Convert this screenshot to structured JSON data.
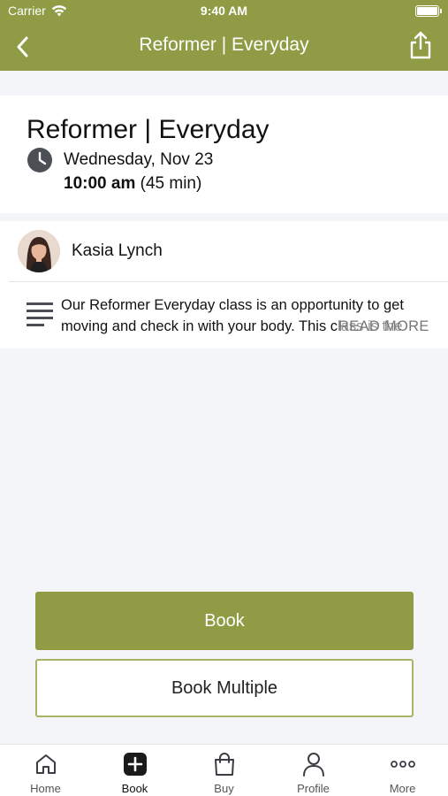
{
  "status_bar": {
    "carrier": "Carrier",
    "time": "9:40 AM"
  },
  "nav": {
    "title": "Reformer | Everyday"
  },
  "class_info": {
    "title": "Reformer | Everyday",
    "date": "Wednesday, Nov 23",
    "time": "10:00 am",
    "duration": "(45 min)"
  },
  "instructor": {
    "name": "Kasia Lynch"
  },
  "description": {
    "text": "Our Reformer Everyday class is an opportunity to get moving and check in with your body. This class is the",
    "read_more": "READ MORE"
  },
  "actions": {
    "book_label": "Book",
    "book_multiple_label": "Book Multiple"
  },
  "tabs": [
    {
      "label": "Home",
      "icon": "home-icon"
    },
    {
      "label": "Book",
      "icon": "plus-square-icon"
    },
    {
      "label": "Buy",
      "icon": "shopping-bag-icon"
    },
    {
      "label": "Profile",
      "icon": "person-icon"
    },
    {
      "label": "More",
      "icon": "more-dots-icon"
    }
  ],
  "colors": {
    "brand": "#8f9c45",
    "background": "#f4f5f9",
    "button_border": "#a9b366"
  }
}
